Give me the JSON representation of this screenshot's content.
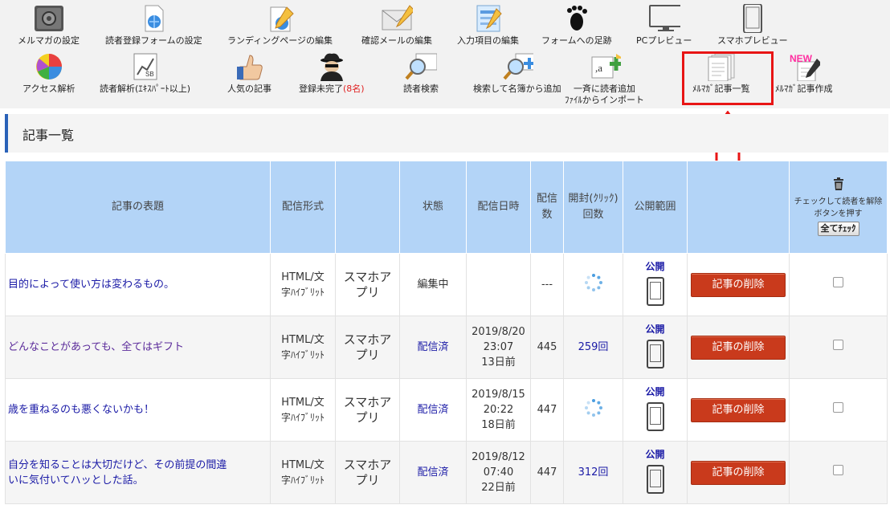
{
  "toolbar": {
    "row1": [
      {
        "label": "メルマガの設定",
        "icon": "settings-icon"
      },
      {
        "label": "読者登録フォームの設定",
        "icon": "web-form-icon"
      },
      {
        "label": "ランディングページの編集",
        "icon": "landing-page-icon"
      },
      {
        "label": "確認メールの編集",
        "icon": "mail-icon"
      },
      {
        "label": "入力項目の編集",
        "icon": "form-fields-icon"
      },
      {
        "label": "フォームへの足跡",
        "icon": "footprint-icon"
      },
      {
        "label": "PCプレビュー",
        "icon": "monitor-icon"
      },
      {
        "label": "スマホプレビュー",
        "icon": "smartphone-icon"
      }
    ],
    "row2": [
      {
        "label": "アクセス解析",
        "icon": "pie-chart-icon"
      },
      {
        "label": "読者解析(ｴｷｽﾊﾟｰﾄ以上)",
        "icon": "analysis-chart-icon"
      },
      {
        "label": "人気の記事",
        "icon": "thumbs-up-icon"
      },
      {
        "label": "登録未完了",
        "count": "(8名)",
        "icon": "spy-icon"
      },
      {
        "label": "読者検索",
        "icon": "search-news-icon"
      },
      {
        "label": "検索して名簿から追加",
        "icon": "search-add-icon"
      },
      {
        "label": "一斉に読者追加",
        "label2": "ﾌｧｲﾙからインポート",
        "icon": "import-file-icon"
      },
      {
        "label": "ﾒﾙﾏｶﾞ記事一覧",
        "icon": "article-list-icon"
      },
      {
        "label": "ﾒﾙﾏｶﾞ記事作成",
        "badge": "NEW",
        "icon": "new-article-icon"
      }
    ]
  },
  "section": {
    "title": "記事一覧"
  },
  "table": {
    "headers": {
      "title": "記事の表題",
      "format": "配信形式",
      "status": "状態",
      "date": "配信日時",
      "sent": "配信数",
      "opens": "開封(ｸﾘｯｸ)回数",
      "scope": "公開範囲",
      "uncheck_note": "チェックして読者を解除ボタンを押す",
      "check_all": "全てﾁｪｯｸ"
    },
    "rows": [
      {
        "title": "目的によって使い方は変わるもの。",
        "format1": "HTML/文",
        "format2": "字ﾊｲﾌﾞﾘｯﾄ",
        "app1": "スマホア",
        "app2": "プリ",
        "status": "編集中",
        "date1": "",
        "date2": "",
        "date3": "",
        "sent": "---",
        "opens": "",
        "scope": "公開",
        "delete": "記事の削除"
      },
      {
        "title": "どんなことがあっても、全てはギフト",
        "format1": "HTML/文",
        "format2": "字ﾊｲﾌﾞﾘｯﾄ",
        "app1": "スマホア",
        "app2": "プリ",
        "status": "配信済",
        "date1": "2019/8/20",
        "date2": "23:07",
        "date3": "13日前",
        "sent": "445",
        "opens": "259回",
        "scope": "公開",
        "delete": "記事の削除"
      },
      {
        "title": "歳を重ねるのも悪くないかも！",
        "format1": "HTML/文",
        "format2": "字ﾊｲﾌﾞﾘｯﾄ",
        "app1": "スマホア",
        "app2": "プリ",
        "status": "配信済",
        "date1": "2019/8/15",
        "date2": "20:22",
        "date3": "18日前",
        "sent": "447",
        "opens": "",
        "scope": "公開",
        "delete": "記事の削除"
      },
      {
        "title1": "自分を知ることは大切だけど、その前提の間違",
        "title2": "いに気付いてハッとした話。",
        "format1": "HTML/文",
        "format2": "字ﾊｲﾌﾞﾘｯﾄ",
        "app1": "スマホア",
        "app2": "プリ",
        "status": "配信済",
        "date1": "2019/8/12",
        "date2": "07:40",
        "date3": "22日前",
        "sent": "447",
        "opens": "312回",
        "scope": "公開",
        "delete": "記事の削除"
      }
    ]
  }
}
